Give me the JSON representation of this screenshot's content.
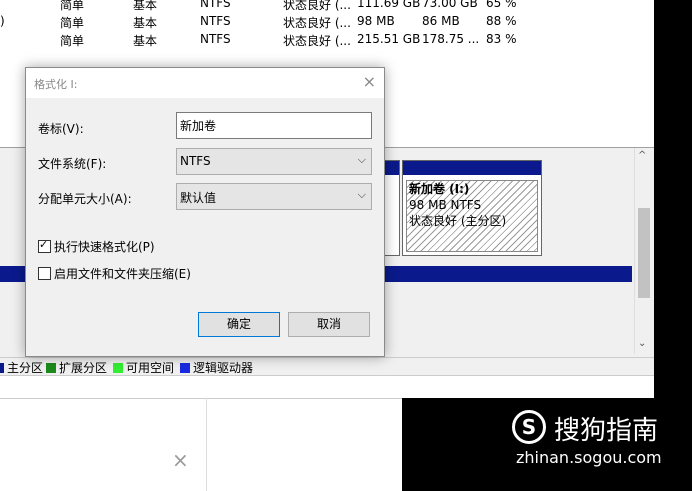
{
  "volume_rows": [
    {
      "layout": "简单",
      "type": "基本",
      "fs": "NTFS",
      "status": "状态良好 (...",
      "capacity": "111.69 GB",
      "free": "73.00 GB",
      "pct": "65 %"
    },
    {
      "layout": "简单",
      "type": "基本",
      "fs": "NTFS",
      "status": "状态良好 (...",
      "capacity": "98 MB",
      "free": "86 MB",
      "pct": "88 %"
    },
    {
      "layout": "简单",
      "type": "基本",
      "fs": "NTFS",
      "status": "状态良好 (...",
      "capacity": "215.51 GB",
      "free": "178.75 ...",
      "pct": "83 %"
    }
  ],
  "row_prefix": ")",
  "partition": {
    "name": "新加卷 (I:)",
    "size": "98 MB NTFS",
    "status": "状态良好 (主分区)"
  },
  "legend": [
    {
      "label": "主分区",
      "color": "#0a1a8c"
    },
    {
      "label": "扩展分区",
      "color": "#1c8a1c"
    },
    {
      "label": "可用空间",
      "color": "#33ee33"
    },
    {
      "label": "逻辑驱动器",
      "color": "#1a2ae0"
    }
  ],
  "dialog": {
    "title": "格式化 I:",
    "volume_label": "卷标(V):",
    "volume_value": "新加卷",
    "fs_label": "文件系统(F):",
    "fs_value": "NTFS",
    "alloc_label": "分配单元大小(A):",
    "alloc_value": "默认值",
    "quick_format": "执行快速格式化(P)",
    "quick_format_checked": true,
    "compression": "启用文件和文件夹压缩(E)",
    "compression_checked": false,
    "ok": "确定",
    "cancel": "取消"
  },
  "icons": {
    "close": "×",
    "chevron": "⌵",
    "check": "✓",
    "scroll_up": "^",
    "scroll_down": "⌄"
  },
  "watermark": {
    "logo": "S",
    "name": "搜狗指南",
    "url": "zhinan.sogou.com"
  }
}
